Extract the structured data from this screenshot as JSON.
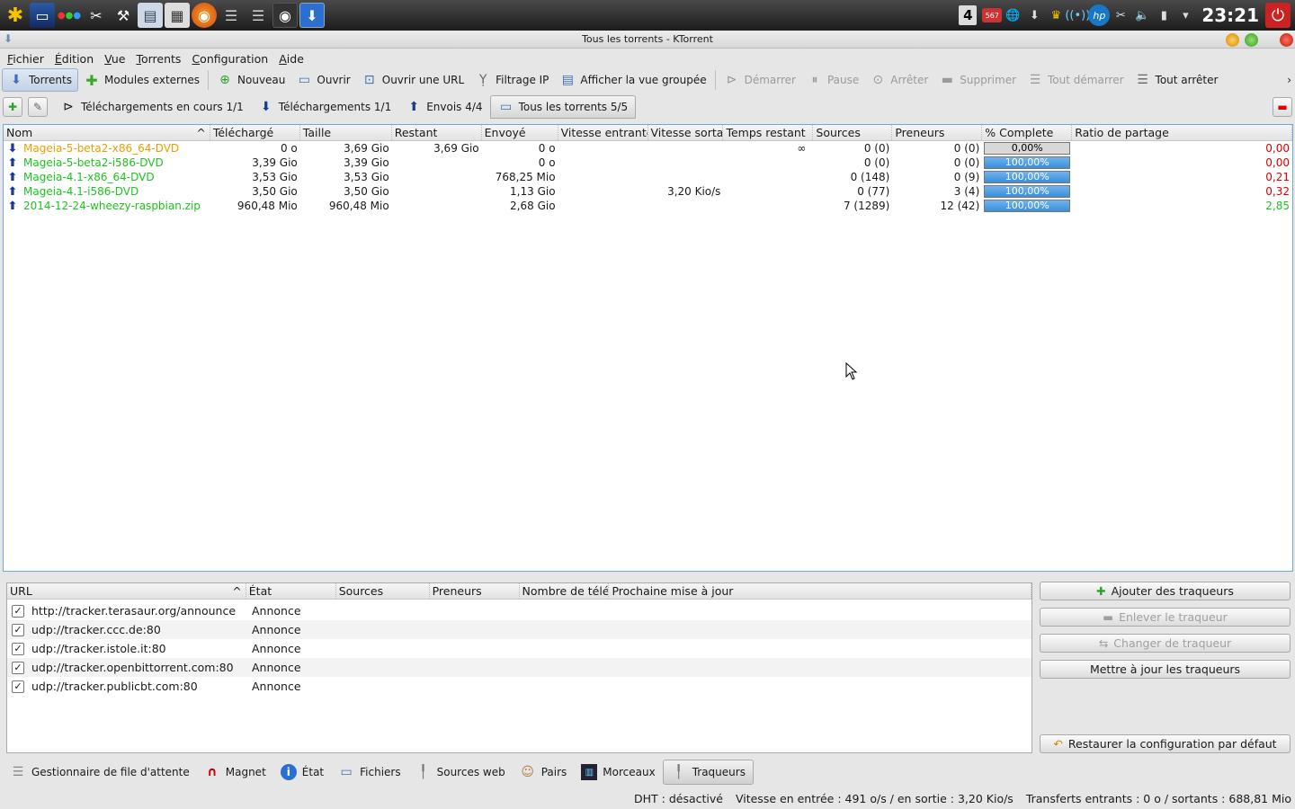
{
  "taskbar": {
    "desktop_number": "4",
    "clock": "23:21",
    "badge_567": "567"
  },
  "window": {
    "title": "Tous les torrents - KTorrent"
  },
  "menu": [
    "Fichier",
    "Édition",
    "Vue",
    "Torrents",
    "Configuration",
    "Aide"
  ],
  "toolbar": {
    "torrents": "Torrents",
    "plugins": "Modules externes",
    "new": "Nouveau",
    "open": "Ouvrir",
    "open_url": "Ouvrir une URL",
    "ip_filter": "Filtrage IP",
    "grouped_view": "Afficher la vue groupée",
    "start": "Démarrer",
    "pause": "Pause",
    "stop": "Arrêter",
    "remove": "Supprimer",
    "start_all": "Tout démarrer",
    "stop_all": "Tout arrêter",
    "more": "›"
  },
  "views": {
    "downloading": "Téléchargements en cours 1/1",
    "downloads": "Téléchargements 1/1",
    "uploads": "Envois 4/4",
    "all": "Tous les torrents 5/5"
  },
  "torrent_table": {
    "headers": [
      "Nom",
      "Téléchargé",
      "Taille",
      "Restant",
      "Envoyé",
      "Vitesse entrante",
      "Vitesse sortante",
      "Temps restant",
      "Sources",
      "Preneurs",
      "% Complete",
      "Ratio de partage"
    ],
    "rows": [
      {
        "dir": "down",
        "name": "Mageia-5-beta2-x86_64-DVD",
        "downloaded": "0 o",
        "size": "3,69 Gio",
        "left": "3,69 Gio",
        "uploaded": "0 o",
        "down_speed": "",
        "up_speed": "",
        "eta": "∞",
        "seeders": "0 (0)",
        "leechers": "0 (0)",
        "complete": "0,00%",
        "complete_value": 0,
        "ratio": "0,00",
        "name_color": "orange",
        "ratio_color": "red"
      },
      {
        "dir": "up",
        "name": "Mageia-5-beta2-i586-DVD",
        "downloaded": "3,39 Gio",
        "size": "3,39 Gio",
        "left": "",
        "uploaded": "0 o",
        "down_speed": "",
        "up_speed": "",
        "eta": "",
        "seeders": "0 (0)",
        "leechers": "0 (0)",
        "complete": "100,00%",
        "complete_value": 100,
        "ratio": "0,00",
        "name_color": "green",
        "ratio_color": "red"
      },
      {
        "dir": "up",
        "name": "Mageia-4.1-x86_64-DVD",
        "downloaded": "3,53 Gio",
        "size": "3,53 Gio",
        "left": "",
        "uploaded": "768,25 Mio",
        "down_speed": "",
        "up_speed": "",
        "eta": "",
        "seeders": "0 (148)",
        "leechers": "0 (9)",
        "complete": "100,00%",
        "complete_value": 100,
        "ratio": "0,21",
        "name_color": "green",
        "ratio_color": "red"
      },
      {
        "dir": "up",
        "name": "Mageia-4.1-i586-DVD",
        "downloaded": "3,50 Gio",
        "size": "3,50 Gio",
        "left": "",
        "uploaded": "1,13 Gio",
        "down_speed": "",
        "up_speed": "3,20 Kio/s",
        "eta": "",
        "seeders": "0 (77)",
        "leechers": "3 (4)",
        "complete": "100,00%",
        "complete_value": 100,
        "ratio": "0,32",
        "name_color": "green",
        "ratio_color": "red"
      },
      {
        "dir": "up",
        "name": "2014-12-24-wheezy-raspbian.zip",
        "downloaded": "960,48 Mio",
        "size": "960,48 Mio",
        "left": "",
        "uploaded": "2,68 Gio",
        "down_speed": "",
        "up_speed": "",
        "eta": "",
        "seeders": "7 (1289)",
        "leechers": "12 (42)",
        "complete": "100,00%",
        "complete_value": 100,
        "ratio": "2,85",
        "name_color": "green",
        "ratio_color": "green"
      }
    ]
  },
  "tracker_table": {
    "headers": [
      "URL",
      "État",
      "Sources",
      "Preneurs",
      "Nombre de téléchargements",
      "Prochaine mise à jour"
    ],
    "rows": [
      {
        "url": "http://tracker.terasaur.org/announce",
        "state": "Annonce"
      },
      {
        "url": "udp://tracker.ccc.de:80",
        "state": "Annonce"
      },
      {
        "url": "udp://tracker.istole.it:80",
        "state": "Annonce"
      },
      {
        "url": "udp://tracker.openbittorrent.com:80",
        "state": "Annonce"
      },
      {
        "url": "udp://tracker.publicbt.com:80",
        "state": "Annonce"
      }
    ]
  },
  "tracker_buttons": {
    "add": "Ajouter des traqueurs",
    "remove": "Enlever le traqueur",
    "change": "Changer de traqueur",
    "update": "Mettre à jour les traqueurs",
    "restore": "Restaurer la configuration par défaut"
  },
  "bottom_tabs": [
    "Gestionnaire de file d'attente",
    "Magnet",
    "État",
    "Fichiers",
    "Sources web",
    "Pairs",
    "Morceaux",
    "Traqueurs"
  ],
  "status": {
    "dht": "DHT : désactivé",
    "speed": "Vitesse en entrée : 491 o/s / en sortie : 3,20 Kio/s",
    "transfers": "Transferts entrants : 0 o / sortants : 688,81 Mio"
  },
  "colors": {
    "accent": "#3a8edb",
    "green": "#1ec21e",
    "orange": "#e8a000",
    "red": "#e00000"
  }
}
